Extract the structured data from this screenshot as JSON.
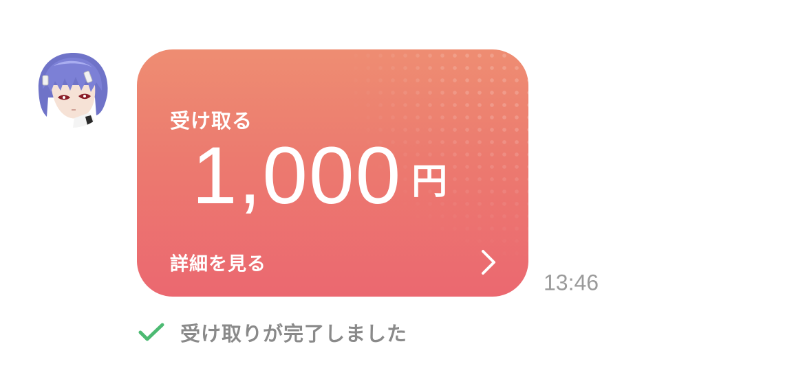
{
  "message": {
    "avatar_icon": "user-avatar",
    "card": {
      "title": "受け取る",
      "amount": "1,000",
      "currency": "円",
      "detail_label": "詳細を見る",
      "chevron_icon": "chevron-right-icon",
      "colors": {
        "gradient_top": "#ee8d72",
        "gradient_bottom": "#eb6870",
        "text": "#ffffff"
      }
    },
    "timestamp": "13:46",
    "status": {
      "icon": "checkmark-icon",
      "text": "受け取りが完了しました",
      "icon_color": "#4cba72",
      "text_color": "#8a8a8a"
    }
  }
}
